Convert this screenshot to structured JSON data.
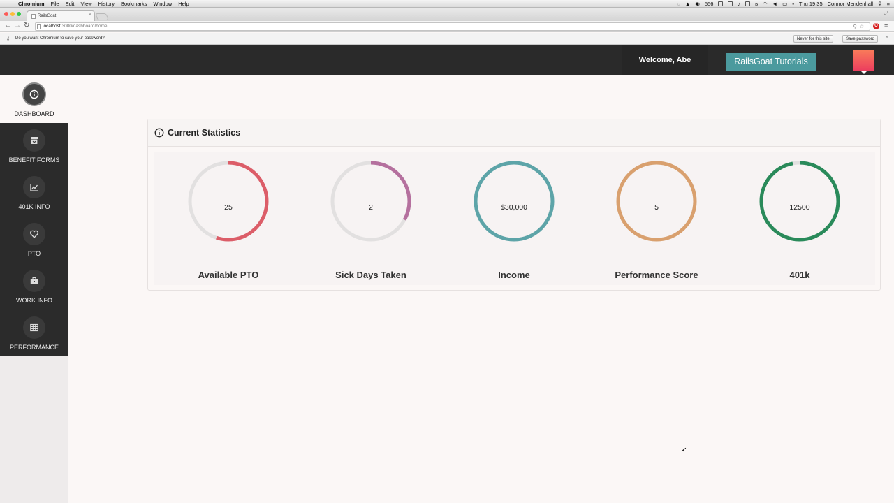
{
  "os_menubar": {
    "apple": "",
    "items": [
      "Chromium",
      "File",
      "Edit",
      "View",
      "History",
      "Bookmarks",
      "Window",
      "Help"
    ],
    "battery_count": "556",
    "clock": "Thu 19:35",
    "user": "Connor Mendenhall"
  },
  "browser": {
    "tab_title": "RailsGoat",
    "url_host": "localhost",
    "url_path": ":3000/dashboard/home",
    "infobar_message": "Do you want Chromium to save your password?",
    "never_button": "Never for this site",
    "save_button": "Save password"
  },
  "header": {
    "welcome": "Welcome, Abe",
    "tutorials_button": "RailsGoat Tutorials"
  },
  "sidebar": {
    "items": [
      {
        "label": "DASHBOARD",
        "icon": "info-icon",
        "active": true
      },
      {
        "label": "BENEFIT FORMS",
        "icon": "archive-icon"
      },
      {
        "label": "401K INFO",
        "icon": "chart-icon"
      },
      {
        "label": "PTO",
        "icon": "heart-icon"
      },
      {
        "label": "WORK INFO",
        "icon": "briefcase-icon"
      },
      {
        "label": "PERFORMANCE",
        "icon": "table-icon"
      }
    ]
  },
  "panel": {
    "title": "Current Statistics",
    "gauges": [
      {
        "value": "25",
        "label": "Available PTO",
        "fraction": 0.55,
        "color": "#dc5d68"
      },
      {
        "value": "2",
        "label": "Sick Days Taken",
        "fraction": 0.33,
        "color": "#b5709e"
      },
      {
        "value": "$30,000",
        "label": "Income",
        "fraction": 1.0,
        "color": "#5da4a8"
      },
      {
        "value": "5",
        "label": "Performance Score",
        "fraction": 1.0,
        "color": "#d9a06e"
      },
      {
        "value": "12500",
        "label": "401k",
        "fraction": 0.97,
        "color": "#2a8a5a"
      }
    ]
  },
  "colors": {
    "topbar": "#2a2a2a",
    "accent": "#4b9a9e",
    "track": "#e2e0e0"
  }
}
